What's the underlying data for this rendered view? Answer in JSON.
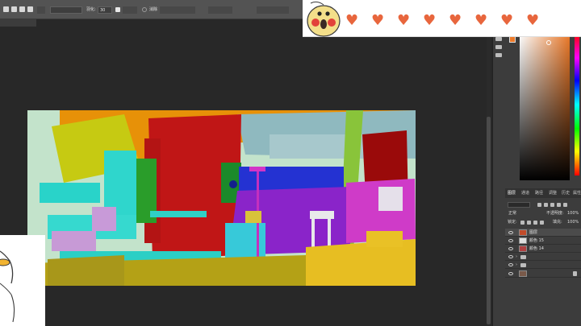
{
  "options_bar": {
    "feather_label": "羽化:",
    "feather_value": "30",
    "antialias_label": "消除"
  },
  "panels": {
    "layers_tabs": [
      "图层",
      "通道",
      "路径",
      "调整",
      "历史",
      "属性"
    ],
    "blend_mode": "正常",
    "opacity_label": "不透明度:",
    "opacity_value": "100%",
    "lock_label": "锁定:",
    "fill_label": "填充:",
    "fill_value": "100%"
  },
  "layers": [
    {
      "name": "图层",
      "type": "layer",
      "selected": true
    },
    {
      "name": "颜色 15",
      "type": "layer",
      "selected": false
    },
    {
      "name": "颜色 14",
      "type": "layer",
      "selected": false
    },
    {
      "name": "",
      "type": "group",
      "selected": false
    },
    {
      "name": "",
      "type": "group",
      "selected": false
    },
    {
      "name": "",
      "type": "layer",
      "selected": false
    }
  ],
  "overlay": {
    "heart_count": 8,
    "heart_color": "#e8663d"
  },
  "colors": {
    "foreground": "#ec7a2a",
    "ui_dark": "#282828",
    "panel": "#3c3c3c"
  },
  "icons": [
    "move-icon",
    "marquee-icon",
    "lasso-icon",
    "eye-icon",
    "folder-icon",
    "lock-icon",
    "heart-icon",
    "duck-sticker"
  ]
}
